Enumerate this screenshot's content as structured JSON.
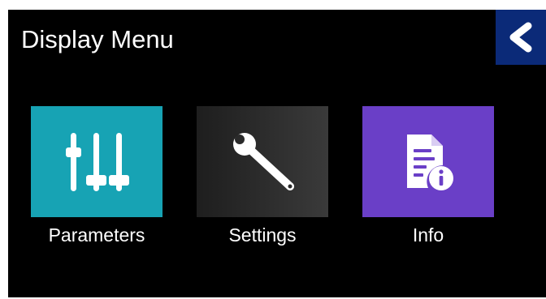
{
  "header": {
    "title": "Display Menu",
    "back_icon": "chevron-left-icon"
  },
  "menu": {
    "items": [
      {
        "label": "Parameters",
        "icon": "sliders-icon",
        "color": "#17a3b4"
      },
      {
        "label": "Settings",
        "icon": "wrench-icon",
        "color": "#2c2c2c"
      },
      {
        "label": "Info",
        "icon": "document-info-icon",
        "color": "#6a3fc7"
      }
    ]
  },
  "colors": {
    "background": "#000000",
    "back_button": "#0b2a78",
    "text": "#ffffff"
  }
}
